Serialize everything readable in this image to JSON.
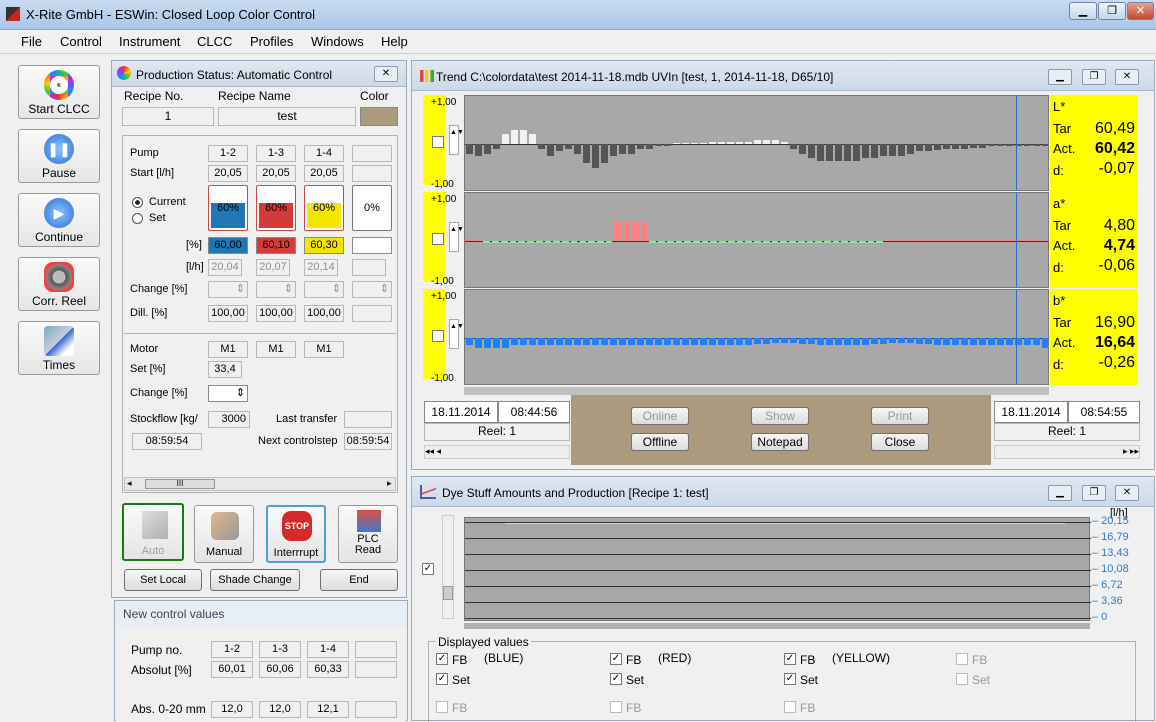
{
  "window": {
    "title": "X-Rite GmbH - ESWin: Closed Loop Color Control",
    "controls": [
      "▁",
      "❐",
      "✕"
    ]
  },
  "menu": [
    "File",
    "Control",
    "Instrument",
    "CLCC",
    "Profiles",
    "Windows",
    "Help"
  ],
  "toolbar": [
    {
      "label": "Start CLCC",
      "icon": "color-wheel-icon"
    },
    {
      "label": "Pause",
      "icon": "pause-icon"
    },
    {
      "label": "Continue",
      "icon": "play-icon"
    },
    {
      "label": "Corr. Reel",
      "icon": "gears-icon"
    },
    {
      "label": "Times",
      "icon": "calculator-clock-icon"
    }
  ],
  "production": {
    "title": "Production Status: Automatic Control",
    "recipe_no_label": "Recipe No.",
    "recipe_name_label": "Recipe Name",
    "color_label": "Color",
    "recipe_no": "1",
    "recipe_name": "test",
    "swatch": "#ab9a7e",
    "pump_label": "Pump",
    "pumps": [
      "1-2",
      "1-3",
      "1-4",
      ""
    ],
    "start_label": "Start [l/h]",
    "start": [
      "20,05",
      "20,05",
      "20,05",
      ""
    ],
    "current_label": "Current",
    "set_label": "Set",
    "tanks": [
      {
        "level": "60%",
        "color": "#1f78b4",
        "pct": 60
      },
      {
        "level": "60%",
        "color": "#d43a3a",
        "pct": 60
      },
      {
        "level": "60%",
        "color": "#f2e600",
        "pct": 60
      },
      {
        "level": "0%",
        "color": "#ffffff",
        "pct": 0
      }
    ],
    "pct_label": "[%]",
    "pct_values": [
      "60,00",
      "60,10",
      "60,30",
      ""
    ],
    "lh_label": "[l/h]",
    "lh_values": [
      "20,04",
      "20,07",
      "20,14",
      ""
    ],
    "change_label": "Change [%]",
    "dill_label": "Dill.     [%]",
    "dill": [
      "100,00",
      "100,00",
      "100,00",
      ""
    ],
    "motor_label": "Motor",
    "motors": [
      "M1",
      "M1",
      "M1"
    ],
    "set_pct_label": "Set [%]",
    "set_pct": "33,4",
    "change2_label": "Change [%]",
    "stockflow_label": "Stockflow [kg/",
    "stockflow": "3000",
    "last_transfer_label": "Last transfer",
    "time1": "08:59:54",
    "next_step_label": "Next controlstep",
    "time2": "08:59:54",
    "scroll_thumb": "III",
    "buttons": [
      {
        "label": "Auto",
        "icon": "auto-icon"
      },
      {
        "label": "Manual",
        "icon": "hand-icon"
      },
      {
        "label": "Interrrupt",
        "icon": "stop-icon",
        "stop": "STOP"
      },
      {
        "label": "PLC Read",
        "icon": "plc-icon"
      }
    ],
    "actions": [
      "Set Local",
      "Shade Change",
      "End"
    ]
  },
  "new_values": {
    "title": "New control values",
    "pump_label": "Pump no.",
    "pumps": [
      "1-2",
      "1-3",
      "1-4",
      ""
    ],
    "abs_label": "Absolut [%]",
    "abs": [
      "60,01",
      "60,06",
      "60,33",
      ""
    ],
    "abs020_label": "Abs. 0-20 mm",
    "abs020": [
      "12,0",
      "12,0",
      "12,1",
      ""
    ]
  },
  "trend": {
    "title": "Trend C:\\colordata\\test 2014-11-18.mdb UVIn [test, 1, 2014-11-18, D65/10]",
    "ymax": "+1,00",
    "ymin": "-1,00",
    "channels": [
      {
        "name": "L*",
        "tar_label": "Tar",
        "act_label": "Act.",
        "d_label": "d:",
        "tar": "60,49",
        "act": "60,42",
        "d": "-0,07"
      },
      {
        "name": "a*",
        "tar_label": "Tar",
        "act_label": "Act.",
        "d_label": "d:",
        "tar": "4,80",
        "act": "4,74",
        "d": "-0,06"
      },
      {
        "name": "b*",
        "tar_label": "Tar",
        "act_label": "Act.",
        "d_label": "d:",
        "tar": "16,90",
        "act": "16,64",
        "d": "-0,26"
      }
    ],
    "start_date": "18.11.2014",
    "start_time": "08:44:56",
    "start_reel": "Reel: 1",
    "end_date": "18.11.2014",
    "end_time": "08:54:55",
    "end_reel": "Reel: 1",
    "buttons": {
      "online": "Online",
      "offline": "Offline",
      "show": "Show",
      "notepad": "Notepad",
      "print": "Print",
      "close": "Close"
    },
    "bars_L": [
      -0.2,
      -0.25,
      -0.2,
      -0.1,
      0.2,
      0.3,
      0.3,
      0.2,
      -0.1,
      -0.25,
      -0.15,
      -0.1,
      -0.2,
      -0.4,
      -0.5,
      -0.4,
      -0.25,
      -0.2,
      -0.2,
      -0.1,
      -0.1,
      -0.05,
      -0.05,
      0,
      0,
      0,
      0,
      0.05,
      0.05,
      0.05,
      0.05,
      0.05,
      0.08,
      0.08,
      0.08,
      0.05,
      -0.1,
      -0.2,
      -0.3,
      -0.35,
      -0.35,
      -0.35,
      -0.35,
      -0.35,
      -0.3,
      -0.3,
      -0.25,
      -0.25,
      -0.25,
      -0.2,
      -0.15,
      -0.15,
      -0.12,
      -0.1,
      -0.1,
      -0.1,
      -0.08,
      -0.08,
      -0.05,
      -0.05,
      -0.05,
      -0.05,
      -0.05,
      -0.05,
      -0.05
    ],
    "bars_a": [
      0.05,
      0,
      -0.03,
      -0.03,
      -0.03,
      -0.03,
      -0.03,
      -0.03,
      -0.03,
      -0.03,
      -0.03,
      -0.03,
      -0.03,
      -0.03,
      -0.03,
      -0.03,
      -0.03,
      0.4,
      0.4,
      0.4,
      0.4,
      -0.03,
      -0.03,
      -0.03,
      -0.03,
      -0.03,
      -0.03,
      -0.03,
      -0.03,
      -0.03,
      -0.03,
      -0.03,
      -0.03,
      -0.03,
      -0.03,
      -0.03,
      -0.03,
      -0.03,
      -0.03,
      -0.03,
      -0.03,
      -0.03,
      -0.03,
      -0.03,
      -0.03,
      -0.03,
      -0.03,
      -0.03,
      0,
      0,
      0,
      0,
      0,
      0,
      0,
      0.03,
      0.03,
      0.03,
      0.03,
      0.03,
      0.03,
      0.03,
      0,
      0,
      0,
      0,
      0
    ],
    "bars_b": [
      -0.15,
      -0.2,
      -0.2,
      -0.2,
      -0.2,
      -0.15,
      -0.15,
      -0.15,
      -0.15,
      -0.15,
      -0.15,
      -0.15,
      -0.15,
      -0.15,
      -0.15,
      -0.15,
      -0.15,
      -0.15,
      -0.15,
      -0.15,
      -0.15,
      -0.15,
      -0.15,
      -0.15,
      -0.15,
      -0.15,
      -0.15,
      -0.15,
      -0.15,
      -0.15,
      -0.15,
      -0.15,
      -0.12,
      -0.12,
      -0.1,
      -0.1,
      -0.1,
      -0.12,
      -0.12,
      -0.15,
      -0.15,
      -0.15,
      -0.15,
      -0.15,
      -0.15,
      -0.12,
      -0.12,
      -0.1,
      -0.1,
      -0.1,
      -0.12,
      -0.12,
      -0.15,
      -0.15,
      -0.15,
      -0.15,
      -0.15,
      -0.15,
      -0.15,
      -0.15,
      -0.15,
      -0.15,
      -0.15,
      -0.15,
      -0.2
    ]
  },
  "dye": {
    "title": "Dye Stuff Amounts and Production [Recipe 1: test]",
    "unit": "[l/h]",
    "ticks": [
      "20,15",
      "16,79",
      "13,43",
      "10,08",
      "6,72",
      "3,36",
      "0"
    ],
    "displayed_label": "Displayed values",
    "cols": [
      {
        "fb": "FB",
        "name": "(BLUE)",
        "set": "Set",
        "checked": true
      },
      {
        "fb": "FB",
        "name": "(RED)",
        "set": "Set",
        "checked": true
      },
      {
        "fb": "FB",
        "name": "(YELLOW)",
        "set": "Set",
        "checked": true
      },
      {
        "fb": "FB",
        "name": "",
        "set": "Set",
        "checked": false
      }
    ],
    "row3": [
      "FB",
      "FB",
      "FB"
    ]
  }
}
